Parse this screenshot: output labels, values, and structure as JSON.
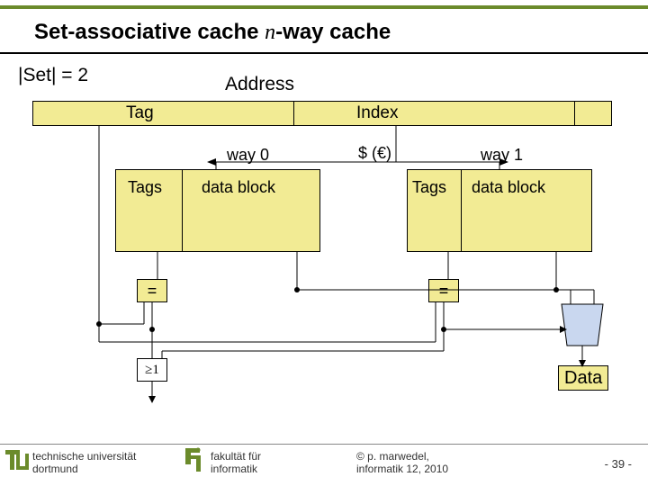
{
  "title_prefix": "Set-associative cache ",
  "title_n": "n",
  "title_suffix": "-way cache",
  "set_label": "|Set| = 2",
  "address_label": "Address",
  "addr_tag": "Tag",
  "addr_index": "Index",
  "way0": "way 0",
  "way1": "way 1",
  "cache_sym": "$ (€)",
  "tags0": "Tags",
  "data0": "data block",
  "tags1": "Tags",
  "data1": "data block",
  "eq": "=",
  "ge1": "≥1",
  "data_out": "Data",
  "footer": {
    "uni1": "technische universität",
    "uni2": "dortmund",
    "fak1": "fakultät für",
    "fak2": "informatik",
    "cp1": "© p. marwedel,",
    "cp2": "informatik 12, 2010",
    "page": "-  39 -"
  }
}
